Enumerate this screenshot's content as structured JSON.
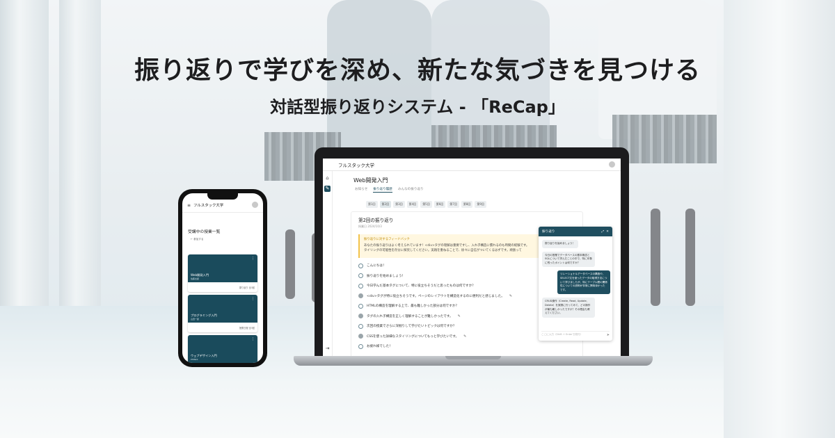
{
  "headline": "振り返りで学びを深め、新たな気づきを見つける",
  "subheadline": "対話型振り返りシステム - 「ReCap」",
  "laptop": {
    "brand": "フルスタック大学",
    "course_title": "Web開発入門",
    "tabs": [
      {
        "label": "お知らせ",
        "active": false
      },
      {
        "label": "振り返り履歴",
        "active": true
      },
      {
        "label": "みんなの振り返り",
        "active": false
      }
    ],
    "sessions": [
      "第1回",
      "第2回",
      "第3回",
      "第4回",
      "第5回",
      "第6回",
      "第7回",
      "第8回",
      "第9回"
    ],
    "panel": {
      "title": "第2回の振り返り",
      "date": "授業日 2024/10/3",
      "feedback_title": "振り返りに対するフィードバック",
      "feedback_line1": "あなたの振り返りはよく考えられています！<div>タグの理解は重要ですし、入れ子構造に慣れるのも時間の経験です。",
      "feedback_line2": "タイリングの可能性を存分に探究してください。実践を重ねることで、徐々に自信がついてくるはずです。頑張って"
    },
    "messages": [
      {
        "role": "bot",
        "text": "こんにちは！"
      },
      {
        "role": "bot",
        "text": "振り返りを始めましょう！"
      },
      {
        "role": "bot",
        "text": "今日学んだ基本タグについて、特に役立ちそうだと思ったものは何ですか？"
      },
      {
        "role": "user",
        "text": "<div>タグが特に役立ちそうです。ページのレイアウトを構造化するのに便利だと感じました。"
      },
      {
        "role": "bot",
        "text": "HTMLの構造を理解する上で、最も難しかった部分は何ですか？"
      },
      {
        "role": "user",
        "text": "タグの入れ子構造を正しく理解することが難しかったです。"
      },
      {
        "role": "bot",
        "text": "次回の授業でさらに深掘りして学びたいトピックは何ですか？"
      },
      {
        "role": "user",
        "text": "CSSを使った詳細なスタイリングについてもっと学びたいです。"
      },
      {
        "role": "bot",
        "text": "お疲れ様でした！"
      }
    ],
    "chat": {
      "title": "振り返り",
      "bubbles": [
        {
          "role": "bot",
          "text": "振り返りを始めましょう！"
        },
        {
          "role": "bot",
          "text": "今日の授業でデータベースの基本概念とSQLについて学んだことの中で、特に印象に残ったポイントは何ですか？"
        },
        {
          "role": "user",
          "text": "リレーショナルデータベースの構造や、SELECT文を使ったデータの取得方法について学びましたが、特にテーブル間の関係性についての説明が非常に興味深かったです。"
        },
        {
          "role": "bot",
          "text": "CRUD操作（Create, Read, Update, Delete）を実際に行ってみて、どの操作が最も難しかったですか？その理由も教えてください。"
        }
      ],
      "input_placeholder": "ここに入力（Shift + Enterで改行）"
    }
  },
  "phone": {
    "brand": "フルスタック大学",
    "section_title": "受講中の授業一覧",
    "sub_link": "← 参加する",
    "courses": [
      {
        "title": "Web開発入門",
        "teacher": "佐藤太郎",
        "meta": "振り返り 全3回"
      },
      {
        "title": "プログラミング入門",
        "teacher": "山田一郎",
        "meta": "授業日程 全3回"
      },
      {
        "title": "ウェブデザイン入門",
        "teacher": "PHINDI",
        "meta": ""
      }
    ]
  }
}
